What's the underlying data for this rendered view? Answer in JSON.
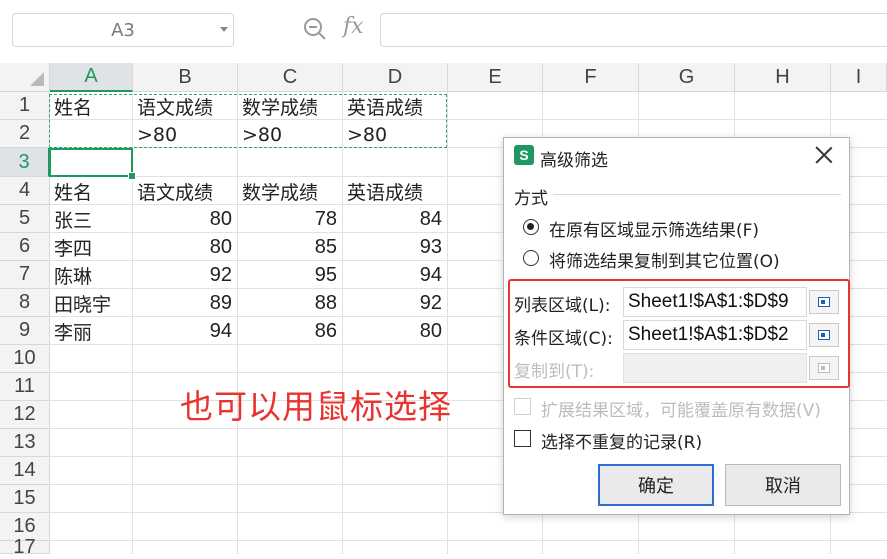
{
  "formula_bar": {
    "name_box": "A3",
    "fx_label": "fx",
    "formula": ""
  },
  "columns": [
    "A",
    "B",
    "C",
    "D",
    "E",
    "F",
    "G",
    "H",
    "I"
  ],
  "rows": [
    "1",
    "2",
    "3",
    "4",
    "5",
    "6",
    "7",
    "8",
    "9",
    "10",
    "11",
    "12",
    "13",
    "14",
    "15",
    "16",
    "17"
  ],
  "cells": {
    "criteria_headers": [
      "姓名",
      "语文成绩",
      "数学成绩",
      "英语成绩"
    ],
    "criteria_values": [
      "",
      ">80",
      ">80",
      ">80"
    ],
    "table_headers": [
      "姓名",
      "语文成绩",
      "数学成绩",
      "英语成绩"
    ],
    "table_rows": [
      [
        "张三",
        "80",
        "78",
        "84"
      ],
      [
        "李四",
        "80",
        "85",
        "93"
      ],
      [
        "陈琳",
        "92",
        "95",
        "94"
      ],
      [
        "田晓宇",
        "89",
        "88",
        "92"
      ],
      [
        "李丽",
        "94",
        "86",
        "80"
      ]
    ]
  },
  "annotation": "也可以用鼠标选择",
  "dialog": {
    "app_icon": "S",
    "title": "高级筛选",
    "method_label": "方式",
    "radio_in_place": "在原有区域显示筛选结果(F)",
    "radio_copy": "将筛选结果复制到其它位置(O)",
    "list_range_label": "列表区域(L):",
    "list_range_value": "Sheet1!$A$1:$D$9",
    "criteria_range_label": "条件区域(C):",
    "criteria_range_value": "Sheet1!$A$1:$D$2",
    "copy_to_label": "复制到(T):",
    "copy_to_value": "",
    "expand_label": "扩展结果区域，可能覆盖原有数据(V)",
    "unique_label": "选择不重复的记录(R)",
    "ok": "确定",
    "cancel": "取消"
  },
  "colors": {
    "accent_green": "#1e9a60",
    "highlight_red": "#e8332f",
    "primary_button_border": "#2b6fd6"
  },
  "icons": {
    "zoom": "zoom-out-icon",
    "close": "close-icon",
    "collapse": "range-picker-icon"
  }
}
